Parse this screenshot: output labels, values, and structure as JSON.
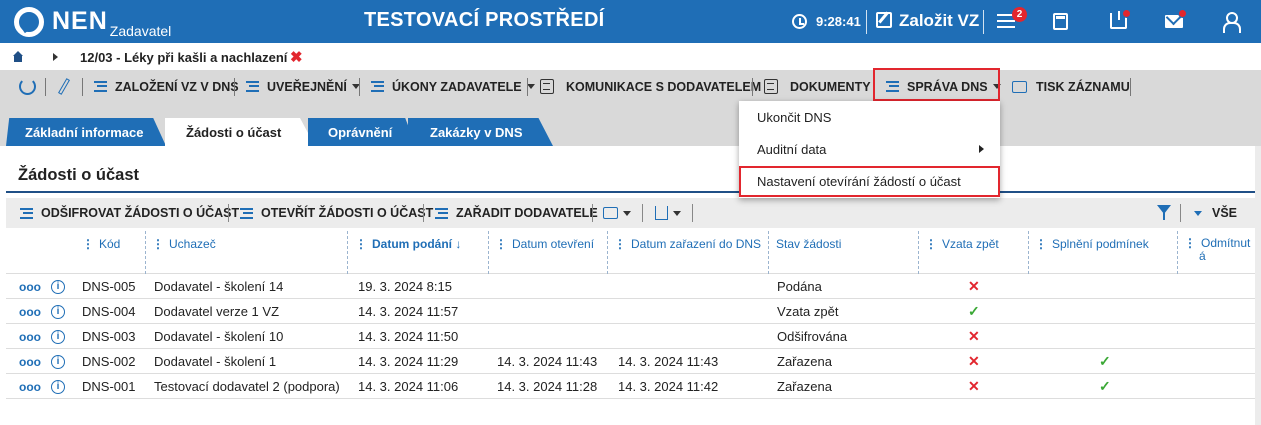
{
  "header": {
    "logo": "NEN",
    "logo_sub": "Zadavatel",
    "env_title": "TESTOVACÍ PROSTŘEDÍ",
    "clock": "9:28:41",
    "new_label": "Založit VZ",
    "menu_badge": "2"
  },
  "breadcrumb": {
    "text": "12/03 - Léky při kašli a nachlazení",
    "close": "✖"
  },
  "toolbar": {
    "zalozeni": "ZALOŽENÍ VZ V DNS",
    "uverejneni": "UVEŘEJNĚNÍ",
    "ukony": "ÚKONY ZADAVATELE",
    "komunikace": "KOMUNIKACE S DODAVATELEM",
    "dokumenty": "DOKUMENTY",
    "sprava": "SPRÁVA DNS",
    "tisk": "TISK ZÁZNAMU"
  },
  "tabs": [
    {
      "label": "Základní informace"
    },
    {
      "label": "Žádosti o účast"
    },
    {
      "label": "Oprávnění"
    },
    {
      "label": "Zakázky v DNS"
    }
  ],
  "panel": {
    "title": "Žádosti o účast"
  },
  "grid_toolbar": {
    "odsifrovat": "ODŠIFROVAT ŽÁDOSTI O ÚČAST",
    "otevrit": "OTEVŘÍT ŽÁDOSTI O ÚČAST",
    "zaradit": "ZAŘADIT DODAVATELE",
    "vse": "VŠE"
  },
  "columns": {
    "kod": "Kód",
    "uchazec": "Uchazeč",
    "datum_podani": "Datum podání ↓",
    "datum_otevreni": "Datum otevření",
    "datum_zarazeni": "Datum zařazení do DNS",
    "stav": "Stav žádosti",
    "vzata": "Vzata zpět",
    "splneni": "Splnění podmínek",
    "odmitnut_1": "Odmítnut",
    "odmitnut_2": "á"
  },
  "rows": [
    {
      "kod": "DNS-005",
      "uchazec": "Dodavatel - školení 14",
      "podani": "19. 3. 2024 8:15",
      "otevreni": "",
      "zarazeni": "",
      "stav": "Podána",
      "vzata": "✕",
      "splneni": ""
    },
    {
      "kod": "DNS-004",
      "uchazec": "Dodavatel verze 1 VZ",
      "podani": "14. 3. 2024 11:57",
      "otevreni": "",
      "zarazeni": "",
      "stav": "Vzata zpět",
      "vzata": "✓",
      "splneni": ""
    },
    {
      "kod": "DNS-003",
      "uchazec": "Dodavatel - školení 10",
      "podani": "14. 3. 2024 11:50",
      "otevreni": "",
      "zarazeni": "",
      "stav": "Odšifrována",
      "vzata": "✕",
      "splneni": ""
    },
    {
      "kod": "DNS-002",
      "uchazec": "Dodavatel - školení 1",
      "podani": "14. 3. 2024 11:29",
      "otevreni": "14. 3. 2024 11:43",
      "zarazeni": "14. 3. 2024 11:43",
      "stav": "Zařazena",
      "vzata": "✕",
      "splneni": "✓"
    },
    {
      "kod": "DNS-001",
      "uchazec": "Testovací dodavatel 2 (podpora)",
      "podani": "14. 3. 2024 11:06",
      "otevreni": "14. 3. 2024 11:28",
      "zarazeni": "14. 3. 2024 11:42",
      "stav": "Zařazena",
      "vzata": "✕",
      "splneni": "✓"
    }
  ],
  "dropdown": {
    "items": [
      {
        "label": "Ukončit DNS"
      },
      {
        "label": "Auditní data"
      },
      {
        "label": "Nastavení otevírání žádostí o účast"
      }
    ]
  },
  "row_more": "ooo",
  "row_info": "i"
}
